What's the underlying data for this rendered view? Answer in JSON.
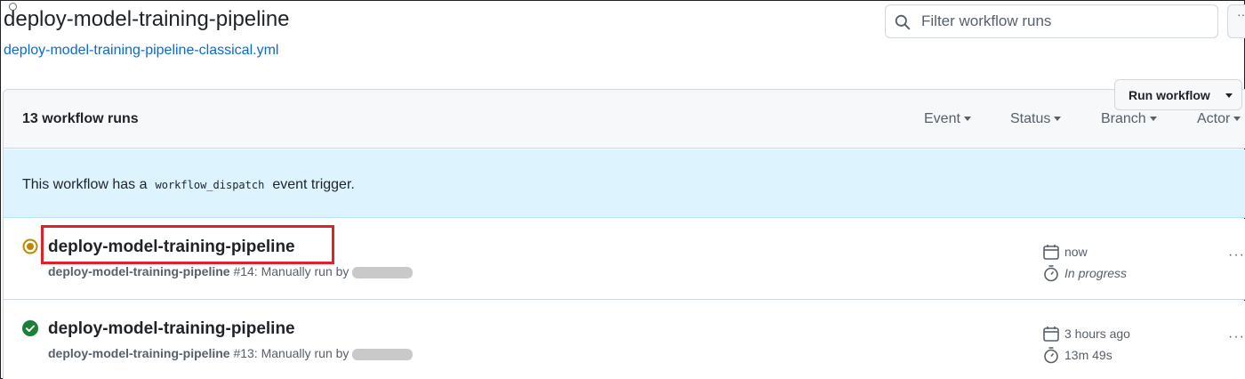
{
  "page": {
    "workflow_title": "deploy-model-training-pipeline",
    "workflow_file": "deploy-model-training-pipeline-classical.yml"
  },
  "search": {
    "placeholder": "Filter workflow runs",
    "value": ""
  },
  "runs_header": {
    "count_label": "13 workflow runs",
    "filters": [
      "Event",
      "Status",
      "Branch",
      "Actor"
    ]
  },
  "dispatch_banner": {
    "text_before": "This workflow has a",
    "code": "workflow_dispatch",
    "text_after": "event trigger.",
    "button_label": "Run workflow"
  },
  "runs": [
    {
      "title": "deploy-model-training-pipeline",
      "workflow_name": "deploy-model-training-pipeline",
      "run_info": "#14: Manually run by",
      "status": "in-progress",
      "time": "now",
      "duration": "In progress"
    },
    {
      "title": "deploy-model-training-pipeline",
      "workflow_name": "deploy-model-training-pipeline",
      "run_info": "#13: Manually run by",
      "status": "success",
      "time": "3 hours ago",
      "duration": "13m 49s"
    }
  ],
  "colors": {
    "link": "#0969da",
    "in_progress": "#bf8700",
    "success": "#1a7f37",
    "banner_bg": "#ddf4ff",
    "highlight": "#e0202a"
  },
  "icons": {
    "search": "search-icon",
    "in_progress": "in-progress-icon",
    "success": "check-circle-icon",
    "calendar": "calendar-icon",
    "stopwatch": "stopwatch-icon",
    "kebab": "kebab-horizontal-icon"
  }
}
